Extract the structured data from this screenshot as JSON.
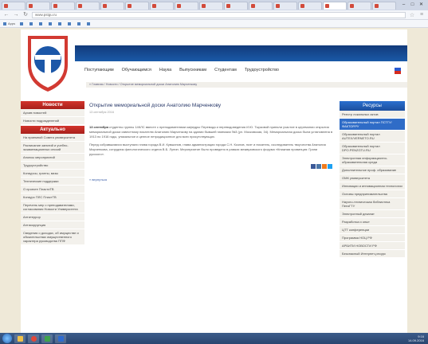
{
  "browser": {
    "tabs": [
      {
        "title": "",
        "active": false
      },
      {
        "title": "",
        "active": false
      },
      {
        "title": "",
        "active": false
      },
      {
        "title": "",
        "active": false
      },
      {
        "title": "",
        "active": false
      },
      {
        "title": "",
        "active": false
      },
      {
        "title": "",
        "active": false
      },
      {
        "title": "",
        "active": false
      },
      {
        "title": "",
        "active": false
      },
      {
        "title": "",
        "active": false
      },
      {
        "title": "",
        "active": false
      },
      {
        "title": "",
        "active": false
      },
      {
        "title": "",
        "active": false
      },
      {
        "title": "",
        "active": true
      },
      {
        "title": "",
        "active": false
      },
      {
        "title": "",
        "active": false
      }
    ],
    "url": "www.pstgu.ru",
    "bookmarks": [
      "Apps",
      "",
      "",
      "",
      "",
      "",
      "",
      "",
      ""
    ]
  },
  "site": {
    "nav": [
      "Поступающим",
      "Обучающимся",
      "Наука",
      "Выпускникам",
      "Студентам",
      "Трудоустройство"
    ],
    "breadcrumb": "« Главная / Новости / Открытие мемориальной доски Анатолию Марченкову",
    "left": {
      "news_head": "Новости",
      "news_items": [
        "Архив новостей",
        "Новости подразделений"
      ],
      "actual_head": "Актуально",
      "actual_items": [
        "На приемной Совета университета",
        "Расписание занятий и учебно-экзаменационных сессий",
        "Анонсы мероприятий",
        "Трудоустройство",
        "Конкурсы, гранты, визы",
        "Технические поддержки",
        "О проекте ПластиТВ",
        "Конкурс ПЛС ПластТВ",
        "Перечень мер с преподавателями, согласования Новости Университета",
        "Антитеррор",
        "Антикоррупция",
        "Сведения о доходах, об имуществе и обязательствах имущественного характера руководства ППФ"
      ]
    },
    "article": {
      "title": "Открытие мемориальной доски Анатолию Марченкову",
      "date": "13 сентября 2016",
      "p1_lead": "13 сентября",
      "p1": " студенты группы 14КЛС вместе с преподавателями кафедры Перевода и переводоведения И.Ю. Тырковой приняли участие в церемонии открытия мемориальной доски известному писателю Анатолию Марченкову на здании бывшей гимназии №3 (ул. Московская, 34). Мемориальная доска была установлена в 1913 по 1916 годы, уникальное и ценное нетрадиционное для всех присутствующих.",
      "p2": "Перед собравшимися выступали глава города В.И. Кувшинов, глава администрации города С.Н. Козлов, поэт и писатель, исследователь творчества Анатолия Марченкова, сотрудник филологического отдела В.Б. Лунин. Мероприятие было проведено в рамках межвузовского форума «Книжная провинция: Грани русского».",
      "back": "« вернуться"
    },
    "right": {
      "head": "Ресурсы",
      "items": [
        {
          "label": "Реестр локальных актов",
          "selected": false
        },
        {
          "label": "Образовательный портал ПСТГУ/ФАКТОР.РУ",
          "selected": true
        },
        {
          "label": "Образовательный портал AUTEX/VERNETO.RU",
          "selected": false
        },
        {
          "label": "Образовательный портал DPO.PENZGTU.RU",
          "selected": false
        },
        {
          "label": "Электронная информационно-образовательная среда",
          "selected": false
        },
        {
          "label": "Дополнительное проф. образование",
          "selected": false
        },
        {
          "label": "ОМК университета",
          "selected": false
        },
        {
          "label": "Инновации и инновационная технологии",
          "selected": false
        },
        {
          "label": "Основы предпринимательства",
          "selected": false
        },
        {
          "label": "Научно-техническая библиотека ПензГТУ",
          "selected": false
        },
        {
          "label": "Электронный деканат",
          "selected": false
        },
        {
          "label": "Разработка и опыт",
          "selected": false
        },
        {
          "label": "ЦТТ конференции",
          "selected": false
        },
        {
          "label": "Программа НОЦ РФ",
          "selected": false
        },
        {
          "label": "АРБИТИ НОВОСТИ РФ",
          "selected": false
        },
        {
          "label": "Безопасный Интернет-ресурс",
          "selected": false
        }
      ]
    }
  },
  "taskbar": {
    "tray_time": "9:16",
    "tray_date": "14.09.2016"
  }
}
